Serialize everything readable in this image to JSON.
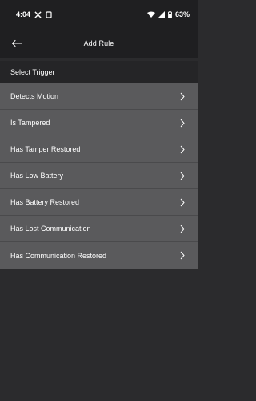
{
  "status_bar": {
    "time": "4:04",
    "battery": "63%",
    "icons": [
      "x-logo-icon",
      "notification-icon",
      "wifi-icon",
      "signal-icon",
      "battery-icon"
    ]
  },
  "header": {
    "title": "Add Rule"
  },
  "section": {
    "label": "Select Trigger"
  },
  "triggers": [
    {
      "label": "Detects Motion"
    },
    {
      "label": "Is Tampered"
    },
    {
      "label": "Has Tamper Restored"
    },
    {
      "label": "Has Low Battery"
    },
    {
      "label": "Has Battery Restored"
    },
    {
      "label": "Has Lost Communication"
    },
    {
      "label": "Has Communication Restored"
    }
  ],
  "colors": {
    "background": "#2b2b2d",
    "bar": "#1f1f21",
    "list_row": "#5a5a5c",
    "text": "#ffffff"
  }
}
